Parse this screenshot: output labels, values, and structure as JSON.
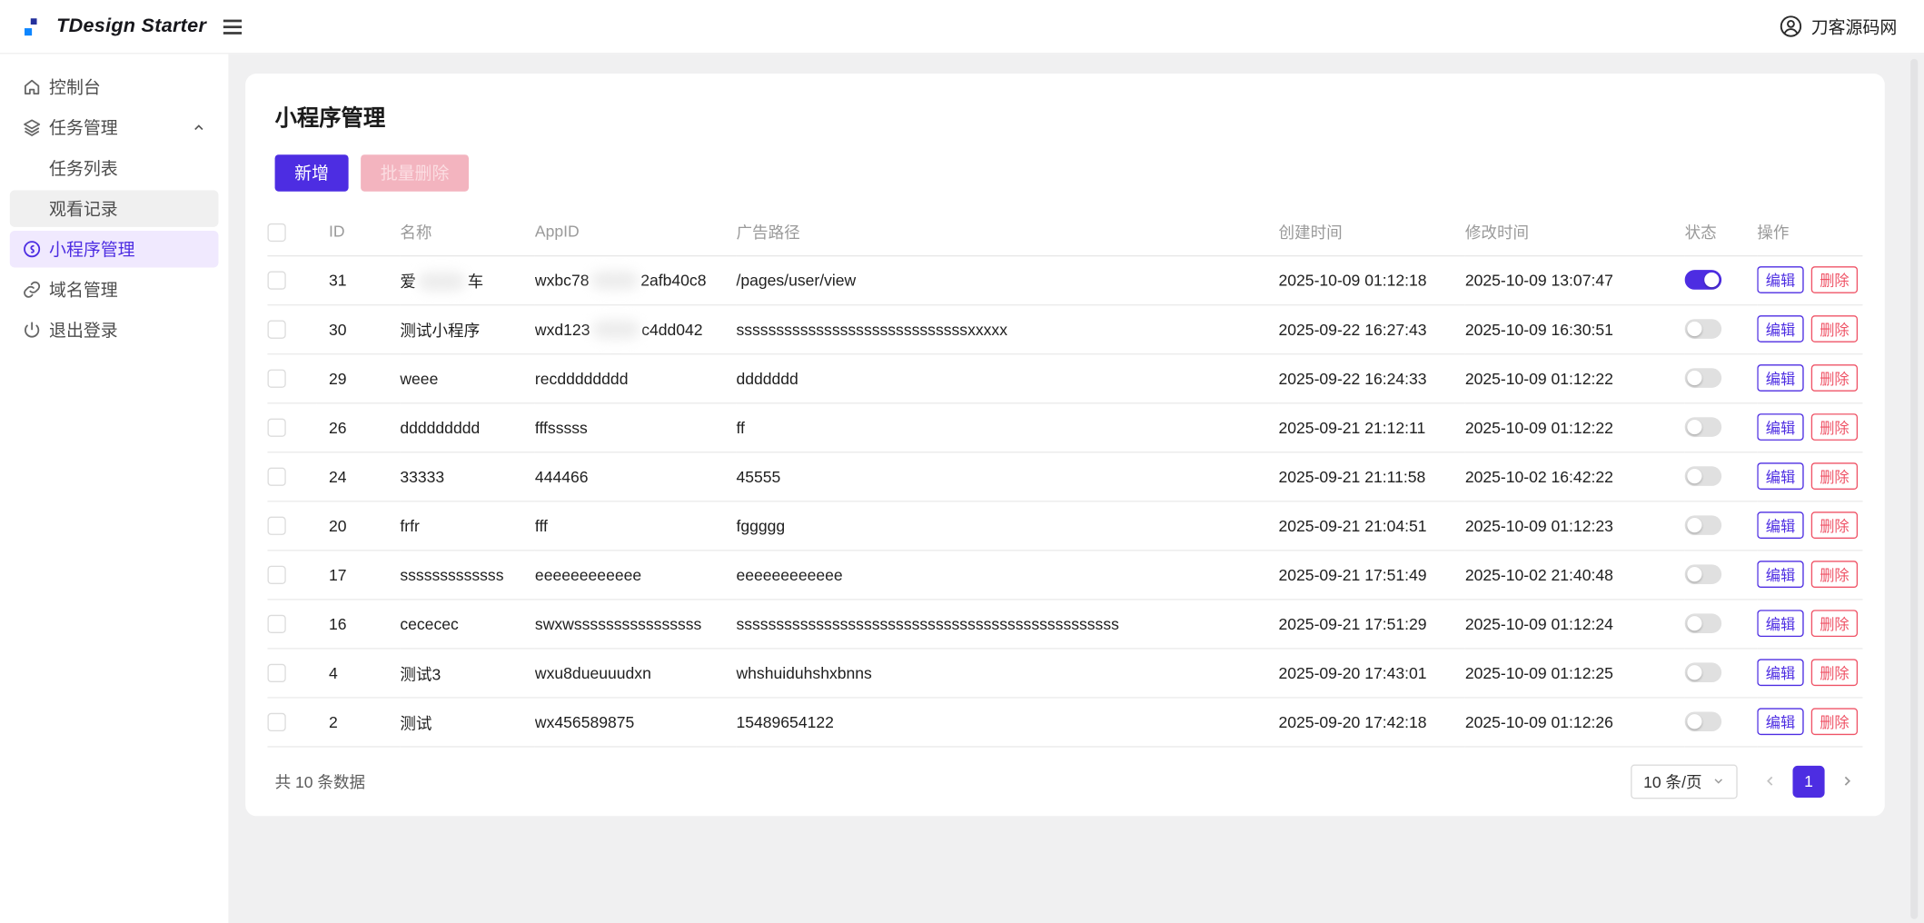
{
  "colors": {
    "primary": "#4d2de2",
    "primary_light_bg": "#f0e9fe",
    "danger": "#ef5467",
    "danger_disabled_bg": "#f3b4bf",
    "danger_disabled_text": "#fbdde2",
    "logo_blue": "#0e86ff",
    "logo_navy": "#24309c"
  },
  "header": {
    "logo_text": "TDesign Starter",
    "user_name": "刀客源码网"
  },
  "sidebar": {
    "items": [
      {
        "label": "控制台",
        "icon": "home-icon"
      },
      {
        "label": "任务管理",
        "icon": "layers-icon",
        "state": "expanded",
        "children": [
          {
            "label": "任务列表"
          },
          {
            "label": "观看记录"
          }
        ]
      },
      {
        "label": "小程序管理",
        "icon": "app-icon",
        "state": "active"
      },
      {
        "label": "域名管理",
        "icon": "link-icon"
      },
      {
        "label": "退出登录",
        "icon": "power-icon"
      }
    ]
  },
  "page": {
    "title": "小程序管理",
    "buttons": {
      "add": "新增",
      "batch_delete": "批量删除"
    }
  },
  "table": {
    "columns": [
      "ID",
      "名称",
      "AppID",
      "广告路径",
      "创建时间",
      "修改时间",
      "状态",
      "操作"
    ],
    "actions": {
      "edit": "编辑",
      "delete": "删除"
    },
    "rows": [
      {
        "id": "31",
        "name": {
          "prefix": "爱",
          "suffix": "车",
          "redacted": true
        },
        "appid": {
          "prefix": "wxbc78",
          "suffix": "2afb40c8",
          "redacted": true
        },
        "path": {
          "text": "/pages/user/view"
        },
        "created": "2025-10-09 01:12:18",
        "modified": "2025-10-09 13:07:47",
        "status_on": true
      },
      {
        "id": "30",
        "name": {
          "text": "测试小程序"
        },
        "appid": {
          "prefix": "wxd123",
          "suffix": "c4dd042",
          "redacted": true
        },
        "path": {
          "text": "sssssssssssssssssssssssssssssxxxxx"
        },
        "created": "2025-09-22 16:27:43",
        "modified": "2025-10-09 16:30:51",
        "status_on": false
      },
      {
        "id": "29",
        "name": {
          "text": "weee"
        },
        "appid": {
          "text": "recdddddddd"
        },
        "path": {
          "text": "ddddddd"
        },
        "created": "2025-09-22 16:24:33",
        "modified": "2025-10-09 01:12:22",
        "status_on": false
      },
      {
        "id": "26",
        "name": {
          "text": "ddddddddd"
        },
        "appid": {
          "text": "fffsssss"
        },
        "path": {
          "text": "ff"
        },
        "created": "2025-09-21 21:12:11",
        "modified": "2025-10-09 01:12:22",
        "status_on": false
      },
      {
        "id": "24",
        "name": {
          "text": "33333"
        },
        "appid": {
          "text": "444466"
        },
        "path": {
          "text": "45555"
        },
        "created": "2025-09-21 21:11:58",
        "modified": "2025-10-02 16:42:22",
        "status_on": false
      },
      {
        "id": "20",
        "name": {
          "text": "frfr"
        },
        "appid": {
          "text": "fff"
        },
        "path": {
          "text": "fggggg"
        },
        "created": "2025-09-21 21:04:51",
        "modified": "2025-10-09 01:12:23",
        "status_on": false
      },
      {
        "id": "17",
        "name": {
          "text": "sssssssssssss"
        },
        "appid": {
          "text": "eeeeeeeeeeee"
        },
        "path": {
          "text": "eeeeeeeeeeee"
        },
        "created": "2025-09-21 17:51:49",
        "modified": "2025-10-02 21:40:48",
        "status_on": false
      },
      {
        "id": "16",
        "name": {
          "text": "cececec"
        },
        "appid": {
          "text": "swxwssssssssssssssss"
        },
        "path": {
          "text": "ssssssssssssssssssssssssssssssssssssssssssssssss"
        },
        "created": "2025-09-21 17:51:29",
        "modified": "2025-10-09 01:12:24",
        "status_on": false
      },
      {
        "id": "4",
        "name": {
          "text": "测试3"
        },
        "appid": {
          "text": "wxu8dueuuudxn"
        },
        "path": {
          "text": "whshuiduhshxbnns"
        },
        "created": "2025-09-20 17:43:01",
        "modified": "2025-10-09 01:12:25",
        "status_on": false
      },
      {
        "id": "2",
        "name": {
          "text": "测试"
        },
        "appid": {
          "text": "wx456589875"
        },
        "path": {
          "text": "15489654122"
        },
        "created": "2025-09-20 17:42:18",
        "modified": "2025-10-09 01:12:26",
        "status_on": false
      }
    ]
  },
  "footer": {
    "total": "共 10 条数据",
    "page_size": "10 条/页",
    "current_page": "1"
  }
}
